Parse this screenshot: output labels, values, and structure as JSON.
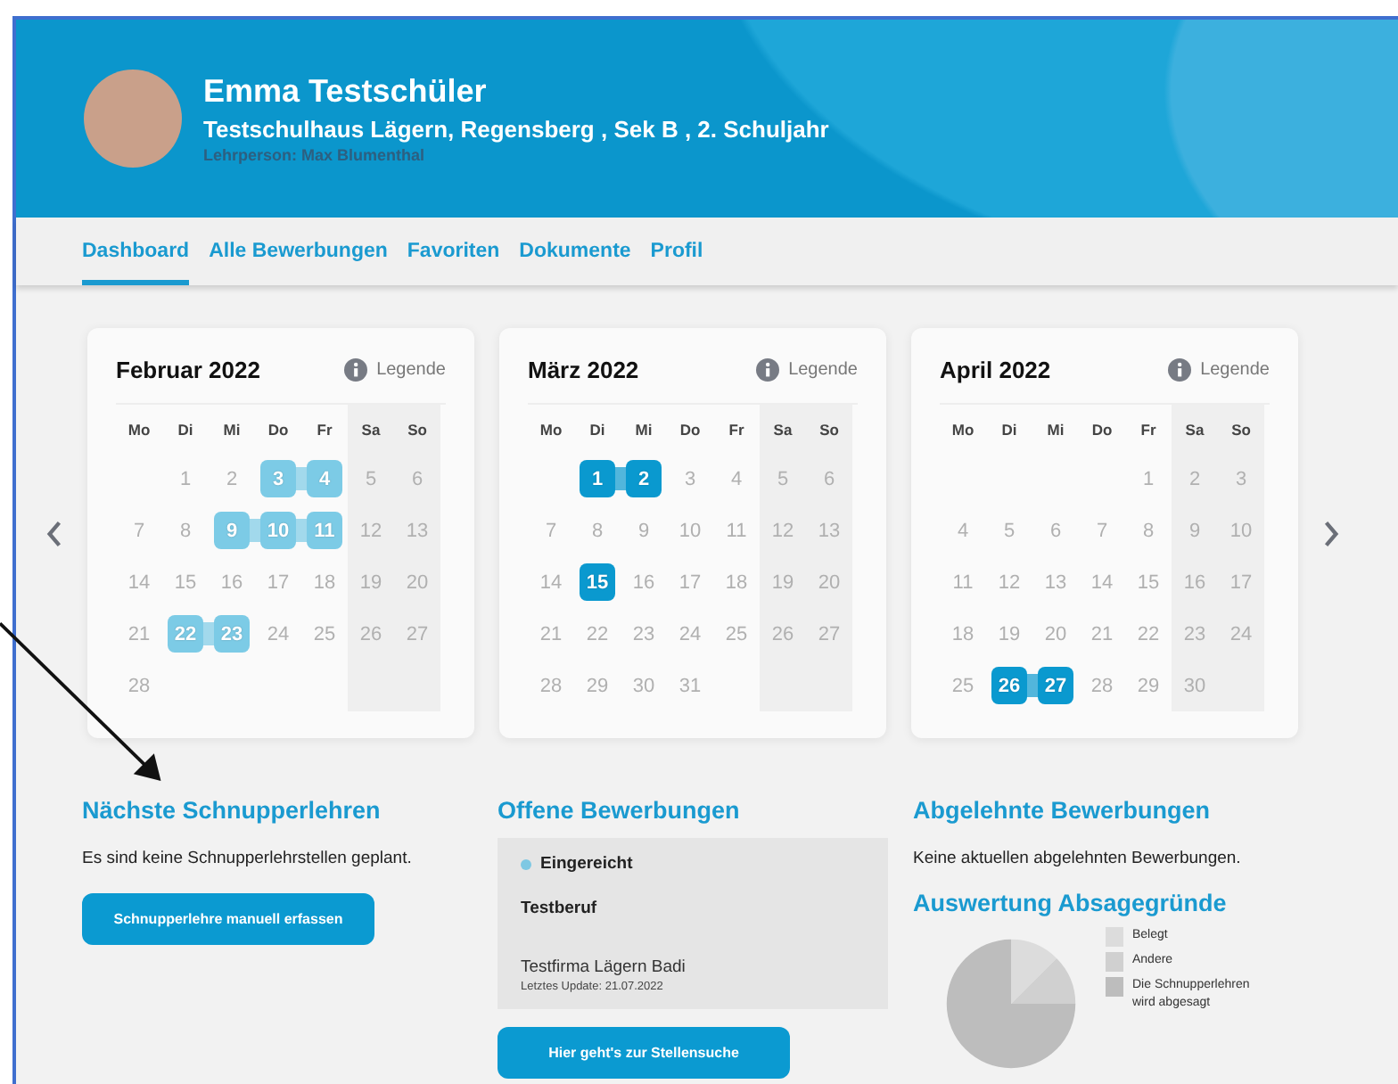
{
  "header": {
    "name": "Emma Testschüler",
    "school": "Testschulhaus Lägern, Regensberg , Sek B , 2. Schuljahr",
    "teacher": "Lehrperson: Max Blumenthal"
  },
  "tabs": [
    {
      "label": "Dashboard",
      "selected": true
    },
    {
      "label": "Alle Bewerbungen",
      "selected": false
    },
    {
      "label": "Favoriten",
      "selected": false
    },
    {
      "label": "Dokumente",
      "selected": false
    },
    {
      "label": "Profil",
      "selected": false
    }
  ],
  "calendars": [
    {
      "title": "Februar 2022",
      "legend": "Legende",
      "weekdays": [
        "Mo",
        "Di",
        "Mi",
        "Do",
        "Fr",
        "Sa",
        "So"
      ],
      "weeks": [
        [
          {
            "kind": "blank"
          },
          {
            "kind": "day",
            "day": "1",
            "marked": false
          },
          {
            "kind": "day",
            "day": "2",
            "marked": false
          },
          {
            "kind": "day",
            "day": "3",
            "marked": true,
            "color": "#7ccbe6"
          },
          {
            "kind": "day",
            "day": "4",
            "marked": true,
            "color": "#7ccbe6"
          },
          {
            "kind": "day",
            "day": "5",
            "marked": false
          },
          {
            "kind": "day",
            "day": "6",
            "marked": false
          }
        ],
        [
          {
            "kind": "day",
            "day": "7",
            "marked": false
          },
          {
            "kind": "day",
            "day": "8",
            "marked": false
          },
          {
            "kind": "day",
            "day": "9",
            "marked": true,
            "color": "#7ccbe6"
          },
          {
            "kind": "day",
            "day": "10",
            "marked": true,
            "color": "#7ccbe6"
          },
          {
            "kind": "day",
            "day": "11",
            "marked": true,
            "color": "#7ccbe6"
          },
          {
            "kind": "day",
            "day": "12",
            "marked": false
          },
          {
            "kind": "day",
            "day": "13",
            "marked": false
          }
        ],
        [
          {
            "kind": "day",
            "day": "14",
            "marked": false
          },
          {
            "kind": "day",
            "day": "15",
            "marked": false
          },
          {
            "kind": "day",
            "day": "16",
            "marked": false
          },
          {
            "kind": "day",
            "day": "17",
            "marked": false
          },
          {
            "kind": "day",
            "day": "18",
            "marked": false
          },
          {
            "kind": "day",
            "day": "19",
            "marked": false
          },
          {
            "kind": "day",
            "day": "20",
            "marked": false
          }
        ],
        [
          {
            "kind": "day",
            "day": "21",
            "marked": false
          },
          {
            "kind": "day",
            "day": "22",
            "marked": true,
            "color": "#7ccbe6"
          },
          {
            "kind": "day",
            "day": "23",
            "marked": true,
            "color": "#7ccbe6"
          },
          {
            "kind": "day",
            "day": "24",
            "marked": false
          },
          {
            "kind": "day",
            "day": "25",
            "marked": false
          },
          {
            "kind": "day",
            "day": "26",
            "marked": false
          },
          {
            "kind": "day",
            "day": "27",
            "marked": false
          }
        ],
        [
          {
            "kind": "day",
            "day": "28",
            "marked": false
          }
        ]
      ]
    },
    {
      "title": "März 2022",
      "legend": "Legende",
      "weekdays": [
        "Mo",
        "Di",
        "Mi",
        "Do",
        "Fr",
        "Sa",
        "So"
      ],
      "weeks": [
        [
          {
            "kind": "blank"
          },
          {
            "kind": "day",
            "day": "1",
            "marked": true,
            "color": "#0a99cf"
          },
          {
            "kind": "day",
            "day": "2",
            "marked": true,
            "color": "#0a99cf"
          },
          {
            "kind": "day",
            "day": "3",
            "marked": false
          },
          {
            "kind": "day",
            "day": "4",
            "marked": false
          },
          {
            "kind": "day",
            "day": "5",
            "marked": false
          },
          {
            "kind": "day",
            "day": "6",
            "marked": false
          }
        ],
        [
          {
            "kind": "day",
            "day": "7",
            "marked": false
          },
          {
            "kind": "day",
            "day": "8",
            "marked": false
          },
          {
            "kind": "day",
            "day": "9",
            "marked": false
          },
          {
            "kind": "day",
            "day": "10",
            "marked": false
          },
          {
            "kind": "day",
            "day": "11",
            "marked": false
          },
          {
            "kind": "day",
            "day": "12",
            "marked": false
          },
          {
            "kind": "day",
            "day": "13",
            "marked": false
          }
        ],
        [
          {
            "kind": "day",
            "day": "14",
            "marked": false
          },
          {
            "kind": "day",
            "day": "15",
            "marked": true,
            "color": "#0a99cf"
          },
          {
            "kind": "day",
            "day": "16",
            "marked": false
          },
          {
            "kind": "day",
            "day": "17",
            "marked": false
          },
          {
            "kind": "day",
            "day": "18",
            "marked": false
          },
          {
            "kind": "day",
            "day": "19",
            "marked": false
          },
          {
            "kind": "day",
            "day": "20",
            "marked": false
          }
        ],
        [
          {
            "kind": "day",
            "day": "21",
            "marked": false
          },
          {
            "kind": "day",
            "day": "22",
            "marked": false
          },
          {
            "kind": "day",
            "day": "23",
            "marked": false
          },
          {
            "kind": "day",
            "day": "24",
            "marked": false
          },
          {
            "kind": "day",
            "day": "25",
            "marked": false
          },
          {
            "kind": "day",
            "day": "26",
            "marked": false
          },
          {
            "kind": "day",
            "day": "27",
            "marked": false
          }
        ],
        [
          {
            "kind": "day",
            "day": "28",
            "marked": false
          },
          {
            "kind": "day",
            "day": "29",
            "marked": false
          },
          {
            "kind": "day",
            "day": "30",
            "marked": false
          },
          {
            "kind": "day",
            "day": "31",
            "marked": false
          }
        ]
      ]
    },
    {
      "title": "April 2022",
      "legend": "Legende",
      "weekdays": [
        "Mo",
        "Di",
        "Mi",
        "Do",
        "Fr",
        "Sa",
        "So"
      ],
      "weeks": [
        [
          {
            "kind": "blank"
          },
          {
            "kind": "blank"
          },
          {
            "kind": "blank"
          },
          {
            "kind": "blank"
          },
          {
            "kind": "day",
            "day": "1",
            "marked": false
          },
          {
            "kind": "day",
            "day": "2",
            "marked": false
          },
          {
            "kind": "day",
            "day": "3",
            "marked": false
          }
        ],
        [
          {
            "kind": "day",
            "day": "4",
            "marked": false
          },
          {
            "kind": "day",
            "day": "5",
            "marked": false
          },
          {
            "kind": "day",
            "day": "6",
            "marked": false
          },
          {
            "kind": "day",
            "day": "7",
            "marked": false
          },
          {
            "kind": "day",
            "day": "8",
            "marked": false
          },
          {
            "kind": "day",
            "day": "9",
            "marked": false
          },
          {
            "kind": "day",
            "day": "10",
            "marked": false
          }
        ],
        [
          {
            "kind": "day",
            "day": "11",
            "marked": false
          },
          {
            "kind": "day",
            "day": "12",
            "marked": false
          },
          {
            "kind": "day",
            "day": "13",
            "marked": false
          },
          {
            "kind": "day",
            "day": "14",
            "marked": false
          },
          {
            "kind": "day",
            "day": "15",
            "marked": false
          },
          {
            "kind": "day",
            "day": "16",
            "marked": false
          },
          {
            "kind": "day",
            "day": "17",
            "marked": false
          }
        ],
        [
          {
            "kind": "day",
            "day": "18",
            "marked": false
          },
          {
            "kind": "day",
            "day": "19",
            "marked": false
          },
          {
            "kind": "day",
            "day": "20",
            "marked": false
          },
          {
            "kind": "day",
            "day": "21",
            "marked": false
          },
          {
            "kind": "day",
            "day": "22",
            "marked": false
          },
          {
            "kind": "day",
            "day": "23",
            "marked": false
          },
          {
            "kind": "day",
            "day": "24",
            "marked": false
          }
        ],
        [
          {
            "kind": "day",
            "day": "25",
            "marked": false
          },
          {
            "kind": "day",
            "day": "26",
            "marked": true,
            "color": "#0a99cf"
          },
          {
            "kind": "day",
            "day": "27",
            "marked": true,
            "color": "#0a99cf"
          },
          {
            "kind": "day",
            "day": "28",
            "marked": false
          },
          {
            "kind": "day",
            "day": "29",
            "marked": false
          },
          {
            "kind": "day",
            "day": "30",
            "marked": false
          }
        ]
      ]
    }
  ],
  "upcoming": {
    "heading": "Nächste Schnupperlehren",
    "text": "Es sind keine Schnupperlehrstellen geplant.",
    "button": "Schnupperlehre manuell erfassen"
  },
  "open_applications": {
    "heading": "Offene Bewerbungen",
    "items": [
      {
        "status": "Eingereicht",
        "color": "#7ec8e3",
        "job": "Testberuf",
        "company": "Testfirma Lägern Badi",
        "updated": "Letztes Update: 21.07.2022"
      }
    ],
    "button": "Hier geht's zur Stellensuche"
  },
  "rejected": {
    "heading": "Abgelehnte Bewerbungen",
    "text": "Keine aktuellen abgelehnten Bewerbungen."
  },
  "analysis": {
    "heading": "Auswertung Absagegründe",
    "legend": [
      {
        "label": "Belegt",
        "color": "#dcdcdc"
      },
      {
        "label": "Andere",
        "color": "#d0d0d0"
      },
      {
        "label": "Die Schnupperlehren wird abgesagt",
        "color": "#bdbdbd"
      }
    ]
  }
}
